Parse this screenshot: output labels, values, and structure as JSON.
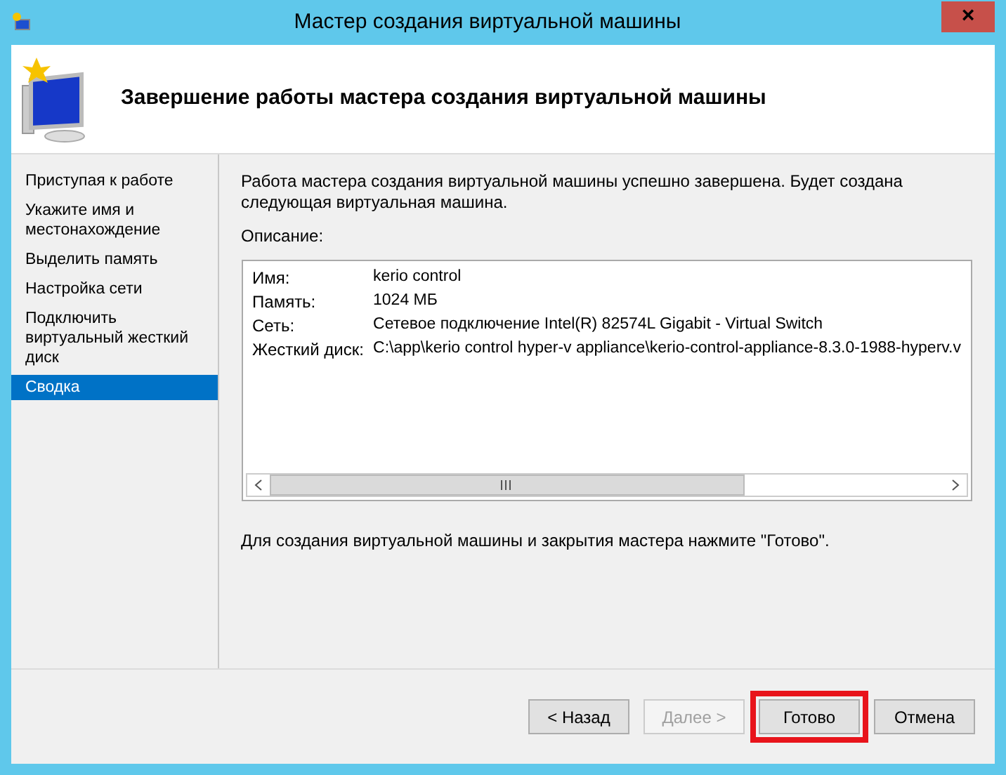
{
  "window": {
    "title": "Мастер создания виртуальной машины",
    "close": "×"
  },
  "header": {
    "title": "Завершение работы мастера создания виртуальной машины"
  },
  "steps": [
    {
      "label": "Приступая к работе",
      "selected": false
    },
    {
      "label": "Укажите имя и местонахождение",
      "selected": false
    },
    {
      "label": "Выделить память",
      "selected": false
    },
    {
      "label": "Настройка сети",
      "selected": false
    },
    {
      "label": "Подключить виртуальный жесткий диск",
      "selected": false
    },
    {
      "label": "Сводка",
      "selected": true
    }
  ],
  "intro": "Работа мастера создания виртуальной машины успешно завершена. Будет создана следующая виртуальная машина.",
  "description_label": "Описание:",
  "summary": [
    {
      "key": "Имя:",
      "value": "kerio control"
    },
    {
      "key": "Память:",
      "value": "1024 МБ"
    },
    {
      "key": "Сеть:",
      "value": "Сетевое подключение Intel(R) 82574L Gigabit - Virtual Switch"
    },
    {
      "key": "Жесткий диск:",
      "value": "C:\\app\\kerio control hyper-v appliance\\kerio-control-appliance-8.3.0-1988-hyperv.v"
    }
  ],
  "outro": "Для создания виртуальной машины и закрытия мастера нажмите \"Готово\".",
  "buttons": [
    {
      "label": "< Назад",
      "disabled": false,
      "highlighted": false
    },
    {
      "label": "Далее >",
      "disabled": true,
      "highlighted": false
    },
    {
      "label": "Готово",
      "disabled": false,
      "highlighted": true
    },
    {
      "label": "Отмена",
      "disabled": false,
      "highlighted": false
    }
  ]
}
